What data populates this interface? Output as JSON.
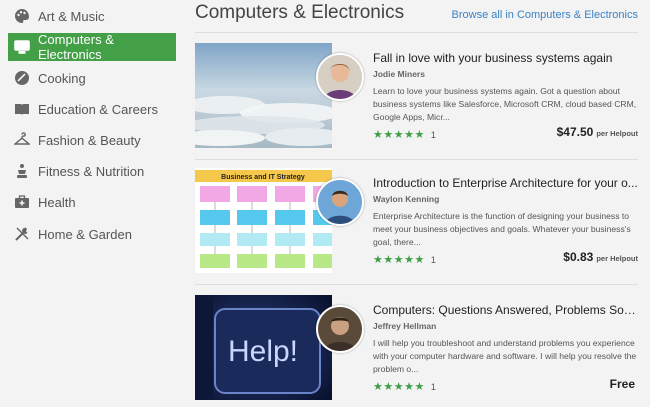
{
  "sidebar": {
    "items": [
      {
        "label": "Art & Music",
        "icon": "palette-icon",
        "active": false
      },
      {
        "label": "Computers & Electronics",
        "icon": "monitor-icon",
        "active": true
      },
      {
        "label": "Cooking",
        "icon": "cooking-icon",
        "active": false
      },
      {
        "label": "Education & Careers",
        "icon": "book-icon",
        "active": false
      },
      {
        "label": "Fashion & Beauty",
        "icon": "hanger-icon",
        "active": false
      },
      {
        "label": "Fitness & Nutrition",
        "icon": "fitness-icon",
        "active": false
      },
      {
        "label": "Health",
        "icon": "medical-kit-icon",
        "active": false
      },
      {
        "label": "Home & Garden",
        "icon": "tools-icon",
        "active": false
      }
    ]
  },
  "main": {
    "heading": "Computers & Electronics",
    "browse_all": "Browse all in Computers & Electronics",
    "cards": [
      {
        "title": "Fall in love with your business systems again",
        "author": "Jodie Miners",
        "description": "Learn to love your business systems again. Got a question about business systems like Salesforce, Microsoft CRM, cloud based CRM, Google Apps, Micr...",
        "stars": "★★★★★",
        "rating_count": "1",
        "price": "$47.50",
        "price_unit": "per Helpout"
      },
      {
        "title": "Introduction to Enterprise Architecture for your o...",
        "author": "Waylon Kenning",
        "description": "Enterprise Architecture is the function of designing your business to meet your business objectives and goals. Whatever your business's goal, there...",
        "stars": "★★★★★",
        "rating_count": "1",
        "price": "$0.83",
        "price_unit": "per Helpout",
        "thumb_title": "Business and IT Strategy"
      },
      {
        "title": "Computers: Questions Answered, Problems Solv...",
        "author": "Jeffrey Hellman",
        "description": "I will help you troubleshoot and understand problems you experience with your computer hardware and software. I will help you resolve the problem o...",
        "stars": "★★★★★",
        "rating_count": "1",
        "price": "Free",
        "price_unit": "",
        "thumb_key_label": "Help!"
      }
    ]
  },
  "colors": {
    "accent_green": "#43a047",
    "star_green": "#3f9f46",
    "link_blue": "#3b82c4",
    "background": "#f3f3f3"
  }
}
